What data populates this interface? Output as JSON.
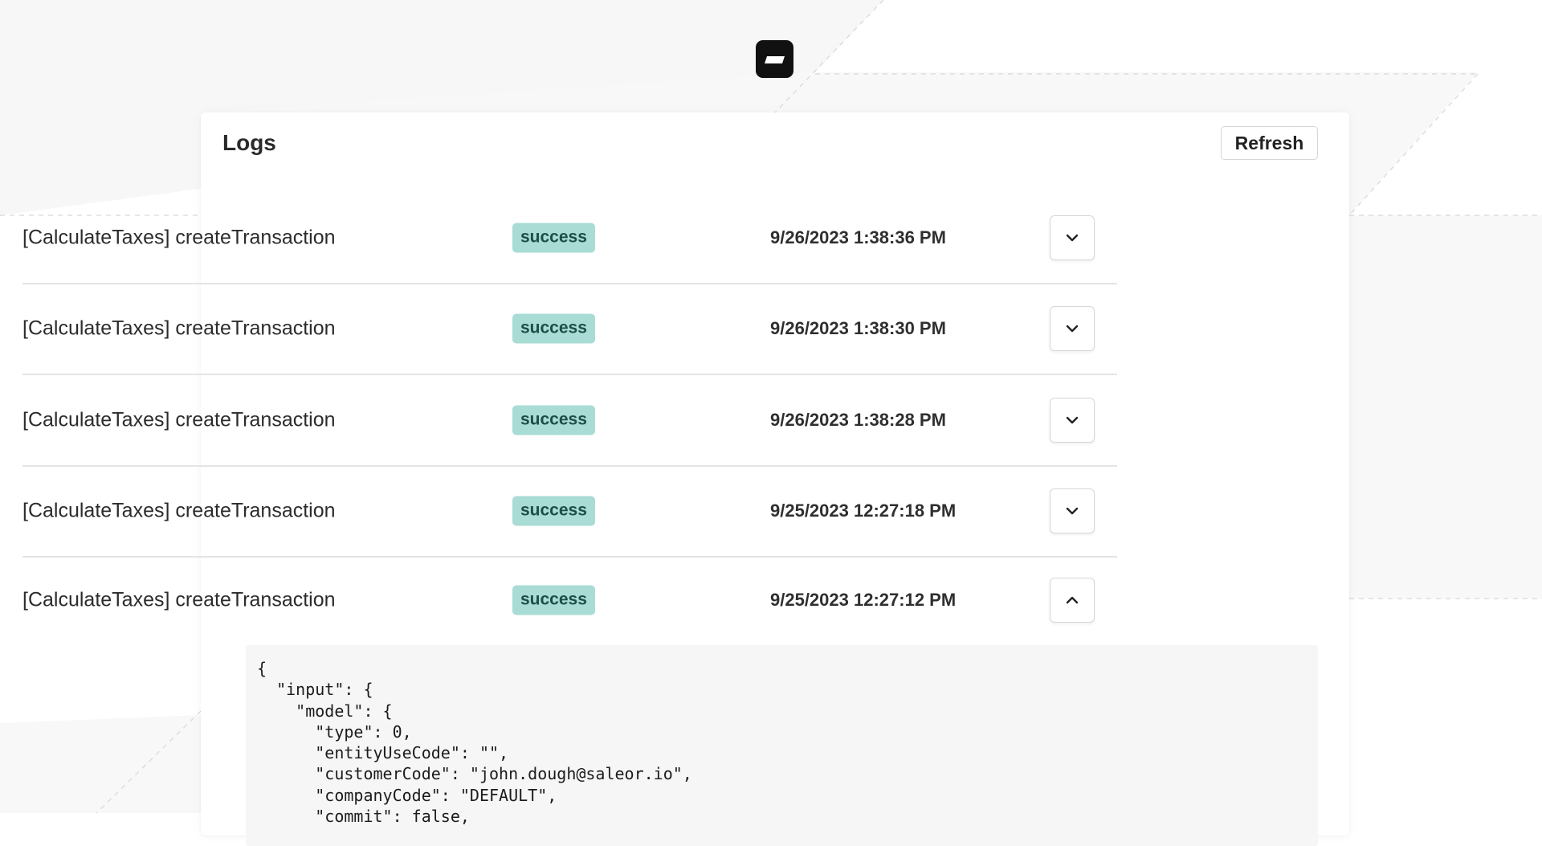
{
  "logs": {
    "title": "Logs",
    "refresh_label": "Refresh",
    "entries": [
      {
        "name": "[CalculateTaxes] createTransaction",
        "status": "success",
        "date": "9/26/2023 1:38:36 PM",
        "expanded": false
      },
      {
        "name": "[CalculateTaxes] createTransaction",
        "status": "success",
        "date": "9/26/2023 1:38:30 PM",
        "expanded": false
      },
      {
        "name": "[CalculateTaxes] createTransaction",
        "status": "success",
        "date": "9/26/2023 1:38:28 PM",
        "expanded": false
      },
      {
        "name": "[CalculateTaxes] createTransaction",
        "status": "success",
        "date": "9/25/2023 12:27:18 PM",
        "expanded": false
      },
      {
        "name": "[CalculateTaxes] createTransaction",
        "status": "success",
        "date": "9/25/2023 12:27:12 PM",
        "expanded": true
      }
    ],
    "expanded_payload": "{\n  \"input\": {\n    \"model\": {\n      \"type\": 0,\n      \"entityUseCode\": \"\",\n      \"customerCode\": \"john.dough@saleor.io\",\n      \"companyCode\": \"DEFAULT\",\n      \"commit\": false,"
  },
  "icons": {
    "logo": "saleor-logo-icon",
    "collapsed_toggle": "chevron-down-icon",
    "expanded_toggle": "chevron-up-icon"
  },
  "colors": {
    "badge_background": "#a8dcd4",
    "badge_text": "#1d4e47",
    "logo": "#111111",
    "json_background": "#f6f6f6"
  }
}
